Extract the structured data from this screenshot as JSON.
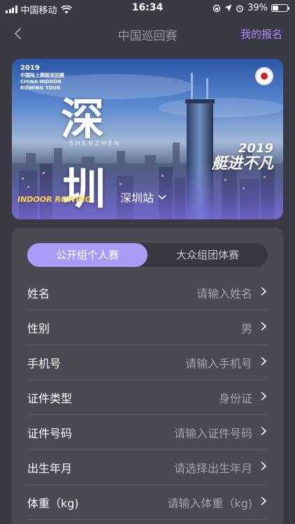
{
  "status_bar": {
    "carrier": "中国移动",
    "time": "16:34",
    "battery": "39%",
    "battery_level": 0.39
  },
  "nav": {
    "title": "中国巡回赛",
    "action": "我的报名"
  },
  "banner": {
    "year": "2019",
    "subtitle_cn": "中国陆上赛艇巡回赛",
    "subtitle_en": "CHINA INDOOR ROWING TOUR",
    "city_char_1": "深",
    "city_char_2": "圳",
    "city_pinyin": "SHENZHEN",
    "station": "深圳站",
    "slogan_year": "2019",
    "slogan": "艇进不凡",
    "bottom_logo": "INDOOR ROWING"
  },
  "tabs": [
    {
      "label": "公开组个人赛",
      "active": true
    },
    {
      "label": "大众组团体赛",
      "active": false
    }
  ],
  "form": {
    "rows": [
      {
        "label": "姓名",
        "value": "请输入姓名"
      },
      {
        "label": "性别",
        "value": "男"
      },
      {
        "label": "手机号",
        "value": "请输入手机号"
      },
      {
        "label": "证件类型",
        "value": "身份证"
      },
      {
        "label": "证件号码",
        "value": "请输入证件号码"
      },
      {
        "label": "出生年月",
        "value": "请选择出生年月"
      },
      {
        "label": "体重（kg)",
        "value": "请输入体重（kg)"
      }
    ]
  },
  "colors": {
    "background": "#3a3a44",
    "card": "#4a4a55",
    "accent": "#a99cf6",
    "nav_action": "#a98cff"
  }
}
